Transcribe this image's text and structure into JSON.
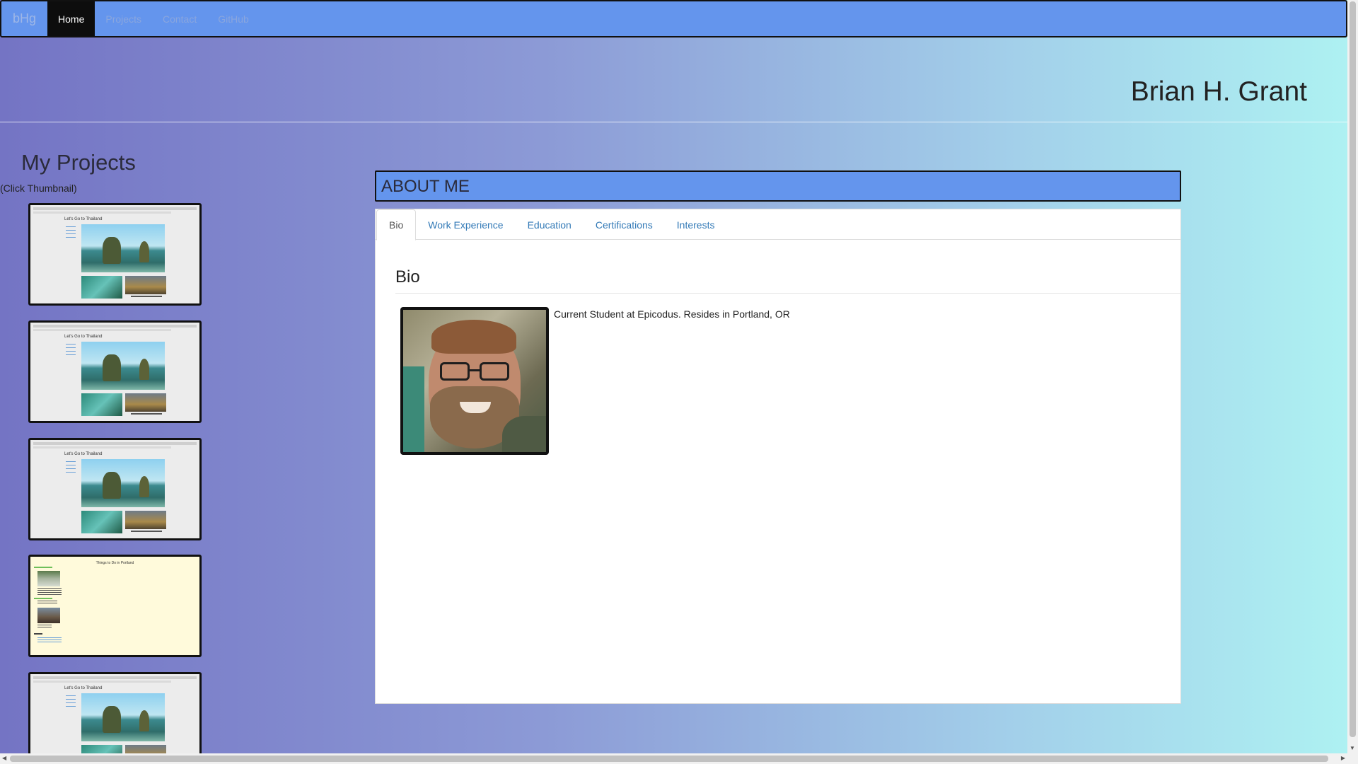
{
  "nav": {
    "brand": "bHg",
    "items": [
      {
        "label": "Home",
        "active": true
      },
      {
        "label": "Projects",
        "active": false
      },
      {
        "label": "Contact",
        "active": false
      },
      {
        "label": "GitHub",
        "active": false
      }
    ]
  },
  "header": {
    "name": "Brian H. Grant"
  },
  "projects": {
    "title": "My Projects",
    "hint": "(Click Thumbnail)",
    "thumbnails": [
      {
        "title": "Let's Go to Thailand"
      },
      {
        "title": "Let's Go to Thailand"
      },
      {
        "title": "Let's Go to Thailand"
      },
      {
        "title": "Things to Do in Portland"
      },
      {
        "title": "Let's Go to Thailand"
      }
    ]
  },
  "about": {
    "heading": "ABOUT ME",
    "tabs": [
      "Bio",
      "Work Experience",
      "Education",
      "Certifications",
      "Interests"
    ],
    "active_tab": "Bio",
    "bio_title": "Bio",
    "bio_text": "Current Student at Epicodus. Resides in Portland, OR"
  },
  "colors": {
    "nav_bg": "#6495ed",
    "gradient_start": "#7474c4",
    "gradient_end": "#aef2f2",
    "tab_link": "#337ab7"
  },
  "icons": {
    "scroll_up": "scroll-up-arrow-icon",
    "scroll_down": "scroll-down-arrow-icon",
    "scroll_left": "scroll-left-arrow-icon",
    "scroll_right": "scroll-right-arrow-icon"
  }
}
